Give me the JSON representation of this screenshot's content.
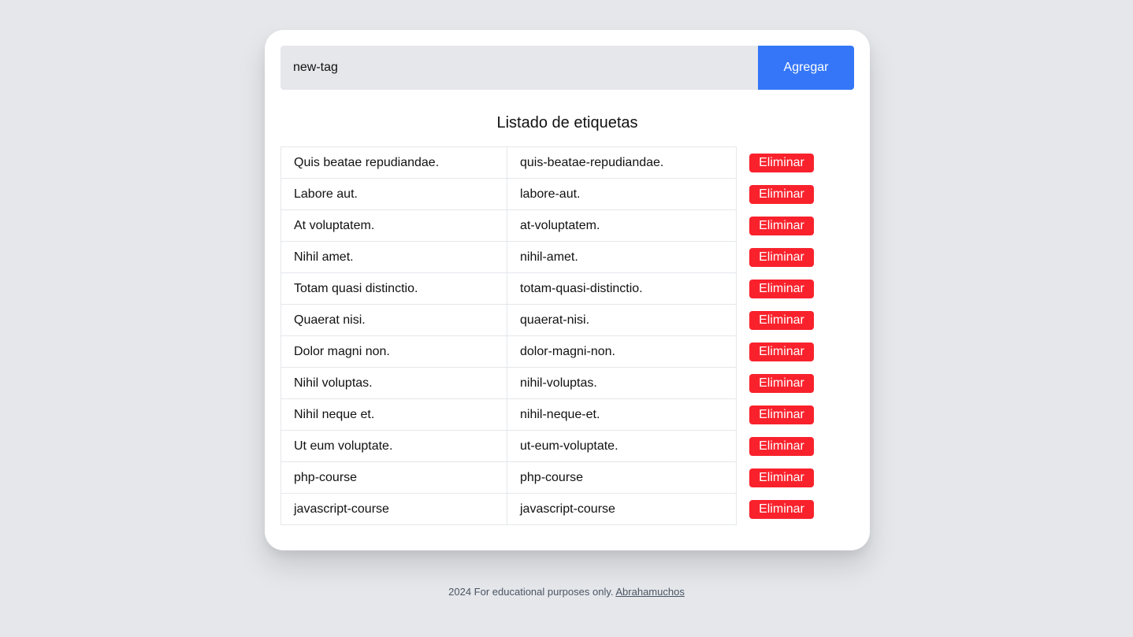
{
  "form": {
    "input_value": "new-tag",
    "add_label": "Agregar"
  },
  "list": {
    "title": "Listado de etiquetas",
    "delete_label": "Eliminar",
    "rows": [
      {
        "name": "Quis beatae repudiandae.",
        "slug": "quis-beatae-repudiandae."
      },
      {
        "name": "Labore aut.",
        "slug": "labore-aut."
      },
      {
        "name": "At voluptatem.",
        "slug": "at-voluptatem."
      },
      {
        "name": "Nihil amet.",
        "slug": "nihil-amet."
      },
      {
        "name": "Totam quasi distinctio.",
        "slug": "totam-quasi-distinctio."
      },
      {
        "name": "Quaerat nisi.",
        "slug": "quaerat-nisi."
      },
      {
        "name": "Dolor magni non.",
        "slug": "dolor-magni-non."
      },
      {
        "name": "Nihil voluptas.",
        "slug": "nihil-voluptas."
      },
      {
        "name": "Nihil neque et.",
        "slug": "nihil-neque-et."
      },
      {
        "name": "Ut eum voluptate.",
        "slug": "ut-eum-voluptate."
      },
      {
        "name": "php-course",
        "slug": "php-course"
      },
      {
        "name": "javascript-course",
        "slug": "javascript-course"
      }
    ]
  },
  "footer": {
    "text": "2024 For educational purposes only.",
    "link_label": "Abrahamuchos"
  },
  "colors": {
    "background": "#e5e7eb",
    "primary": "#3476f7",
    "danger": "#f9222c"
  }
}
